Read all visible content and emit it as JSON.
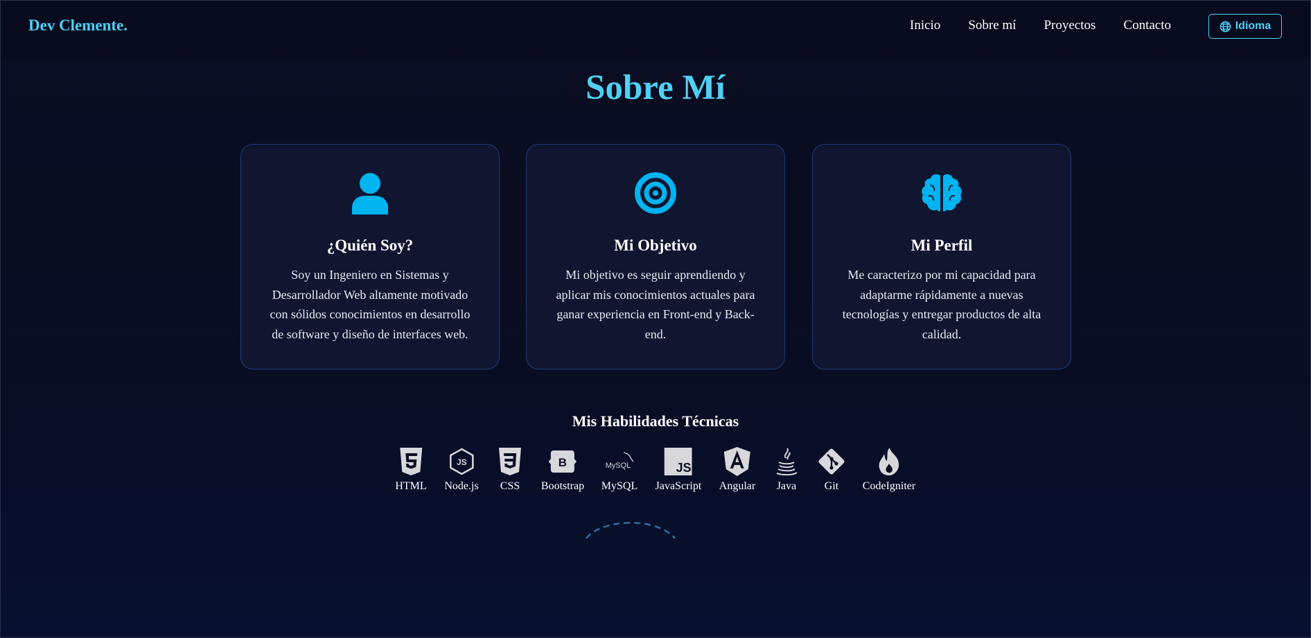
{
  "header": {
    "brand": "Dev Clemente.",
    "nav": [
      "Inicio",
      "Sobre mí",
      "Proyectos",
      "Contacto"
    ],
    "language_button": "Idioma"
  },
  "about": {
    "title": "Sobre Mí",
    "cards": [
      {
        "icon": "user-icon",
        "title": "¿Quién Soy?",
        "text": "Soy un Ingeniero en Sistemas y Desarrollador Web altamente motivado con sólidos conocimientos en desarrollo de software y diseño de interfaces web."
      },
      {
        "icon": "target-icon",
        "title": "Mi Objetivo",
        "text": "Mi objetivo es seguir aprendiendo y aplicar mis conocimientos actuales para ganar experiencia en Front-end y Back-end."
      },
      {
        "icon": "brain-icon",
        "title": "Mi Perfil",
        "text": "Me caracterizo por mi capacidad para adaptarme rápidamente a nuevas tecnologías y entregar productos de alta calidad."
      }
    ]
  },
  "skills": {
    "title": "Mis Habilidades Técnicas",
    "items": [
      {
        "label": "HTML",
        "icon": "html5-icon"
      },
      {
        "label": "Node.js",
        "icon": "nodejs-icon"
      },
      {
        "label": "CSS",
        "icon": "css3-icon"
      },
      {
        "label": "Bootstrap",
        "icon": "bootstrap-icon"
      },
      {
        "label": "MySQL",
        "icon": "mysql-icon"
      },
      {
        "label": "JavaScript",
        "icon": "javascript-icon"
      },
      {
        "label": "Angular",
        "icon": "angular-icon"
      },
      {
        "label": "Java",
        "icon": "java-icon"
      },
      {
        "label": "Git",
        "icon": "git-icon"
      },
      {
        "label": "CodeIgniter",
        "icon": "codeigniter-icon"
      }
    ],
    "icon_mysql_text": "MySQL",
    "icon_js_text": "JS"
  },
  "colors": {
    "accent": "#4fd1f5",
    "icon_blue": "#00b4f0",
    "skill_icon": "#d8d8dc"
  }
}
